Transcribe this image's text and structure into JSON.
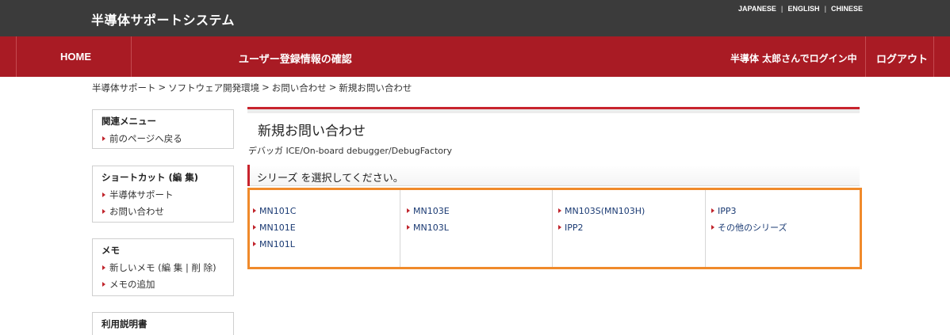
{
  "header": {
    "site_title": "半導体サポートシステム",
    "languages": [
      "JAPANESE",
      "ENGLISH",
      "CHINESE"
    ]
  },
  "nav": {
    "home": "HOME",
    "page_title": "ユーザー登録情報の確認",
    "user_status": "半導体 太郎さんでログイン中",
    "logout": "ログアウト"
  },
  "breadcrumb": [
    "半導体サポート",
    "ソフトウェア開発環境",
    "お問い合わせ",
    "新規お問い合わせ"
  ],
  "sidebar": {
    "related": {
      "title": "関連メニュー",
      "links": [
        "前のページへ戻る"
      ]
    },
    "shortcut": {
      "title": "ショートカット (編 集)",
      "links": [
        "半導体サポート",
        "お問い合わせ"
      ]
    },
    "memo": {
      "title": "メモ",
      "links": [
        "新しいメモ (編 集 | 削 除)",
        "メモの追加"
      ]
    },
    "manual": {
      "title": "利用説明書"
    }
  },
  "main": {
    "title": "新規お問い合わせ",
    "subtitle": "デバッガ  ICE/On-board debugger/DebugFactory",
    "section_heading": "シリーズ を選択してください。",
    "series_columns": [
      [
        "MN101C",
        "MN101E",
        "MN101L"
      ],
      [
        "MN103E",
        "MN103L"
      ],
      [
        "MN103S(MN103H)",
        "IPP2"
      ],
      [
        "IPP3",
        "その他のシリーズ"
      ]
    ]
  },
  "colors": {
    "topbar": "#3b3b3b",
    "nav": "#a91b24",
    "accent_red": "#c8242d",
    "highlight_orange": "#f08a2b",
    "link_blue": "#1a3a73"
  }
}
